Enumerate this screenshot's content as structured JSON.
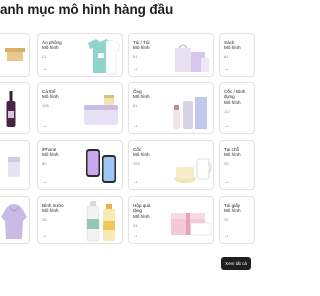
{
  "header": {
    "title": "anh mục mô hình hàng đầu"
  },
  "cards": [
    {
      "label": "Áo phông\nMô hình",
      "count": "21"
    },
    {
      "label": "Túi / Túi\nMô hình",
      "count": "51"
    },
    {
      "label": "Sách\nMô hình",
      "count": "61"
    },
    {
      "label": "Cá thể\nMô hình",
      "count": "195"
    },
    {
      "label": "Ống\nMô hình",
      "count": "61"
    },
    {
      "label": "Cốc / Bình\nđựng\nMô hình",
      "count": "117"
    },
    {
      "label": "iPhone\nMô hình",
      "count": "80"
    },
    {
      "label": "Cốc\nMô hình",
      "count": "153"
    },
    {
      "label": "Tại chỗ\nMô hình",
      "count": "93"
    },
    {
      "label": "Bình nước\nMô hình",
      "count": "28"
    },
    {
      "label": "Hộp quà\ntặng\nMô hình",
      "count": "24"
    },
    {
      "label": "Túi giấy\nMô hình",
      "count": "20"
    }
  ],
  "arrow_glyph": "→",
  "view_all_button": {
    "label": "Xem tất cả"
  },
  "colors": {
    "button_bg": "#1f1f1f",
    "card_border": "#e3e3e3"
  }
}
